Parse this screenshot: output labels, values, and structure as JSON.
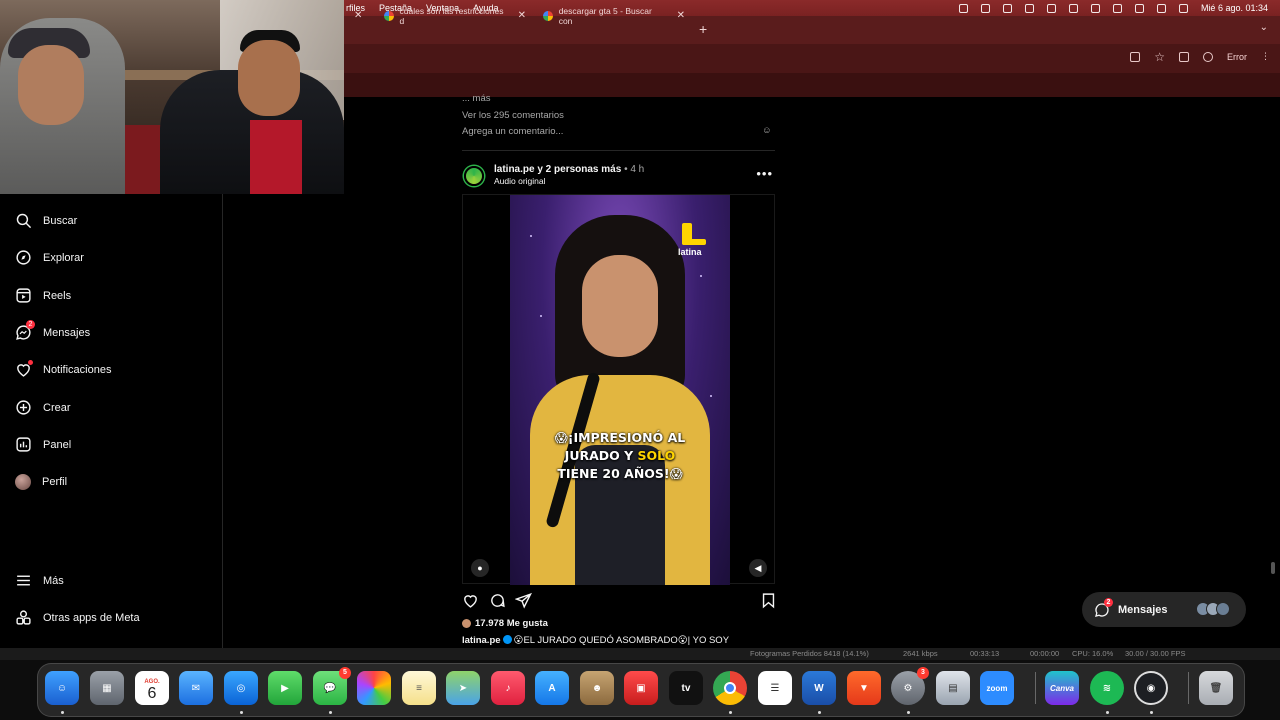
{
  "menubar": {
    "items": [
      "rfiles",
      "Pestaña",
      "Ventana",
      "Ayuda"
    ],
    "datetime": "Mié 6 ago.  01:34"
  },
  "tabs": [
    {
      "title": "cuales son las restricciones d"
    },
    {
      "title": "descargar gta 5 - Buscar con"
    }
  ],
  "toolbar": {
    "error_label": "Error"
  },
  "feed": {
    "prev_more": "... más",
    "view_comments": "Ver los 295 comentarios",
    "add_comment": "Agrega un comentario..."
  },
  "post": {
    "user": "latina.pe y 2 personas más",
    "time": "• 4 h",
    "audio": "Audio original",
    "logo_text": "latina",
    "caption_line1": "😱¡IMPRESIONÓ AL",
    "caption_line2_a": "JURADO Y ",
    "caption_line2_b": "SOLO",
    "caption_line3": "TIENE 20 AÑOS!😱",
    "likes": "17.978 Me gusta",
    "caption_user": "latina.pe",
    "caption_text": "😮EL JURADO QUEDÓ ASOMBRADO😮| YO SOY"
  },
  "sidebar": {
    "items": [
      {
        "label": "Buscar",
        "icon": "search-icon"
      },
      {
        "label": "Explorar",
        "icon": "compass-icon"
      },
      {
        "label": "Reels",
        "icon": "reels-icon"
      },
      {
        "label": "Mensajes",
        "icon": "messenger-icon",
        "badge": "2"
      },
      {
        "label": "Notificaciones",
        "icon": "heart-icon"
      },
      {
        "label": "Crear",
        "icon": "plus-icon"
      },
      {
        "label": "Panel",
        "icon": "chart-icon"
      },
      {
        "label": "Perfil",
        "icon": "avatar"
      }
    ],
    "more": "Más",
    "meta_apps": "Otras apps de Meta"
  },
  "messages_pill": {
    "label": "Mensajes",
    "badge": "2"
  },
  "obs": {
    "dropped": "Fotogramas Perdidos 8418 (14.1%)",
    "bitrate": "2641 kbps",
    "live_time": "00:33:13",
    "rec_time": "00:00:00",
    "cpu": "CPU: 16.0%",
    "fps": "30.00 / 30.00 FPS"
  },
  "dock": {
    "calendar_month": "AGO.",
    "calendar_day": "6",
    "messages_badge": "5",
    "settings_badge": "3",
    "zoom_label": "zoom",
    "canva_label": "Canva",
    "tv_label": "tv"
  },
  "colors": {
    "menubar": "#8b2a2a",
    "accent": "#0095f6",
    "badge": "#ff3040"
  }
}
